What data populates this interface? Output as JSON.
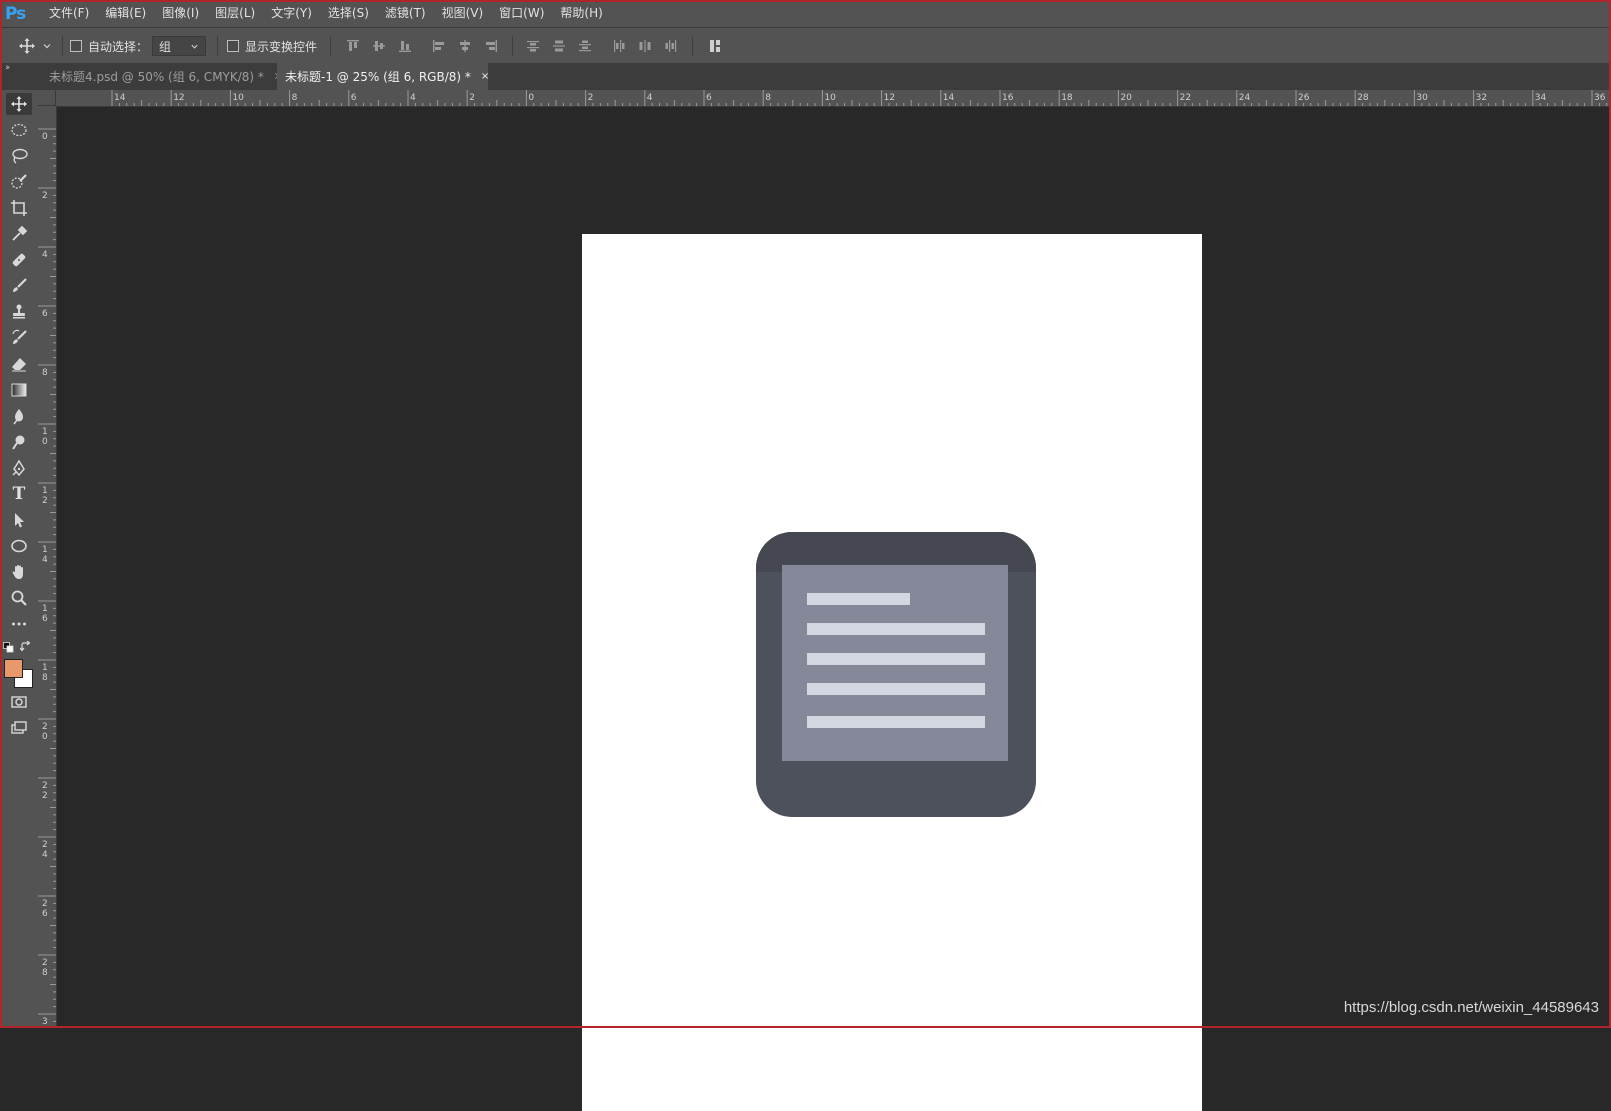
{
  "app": {
    "logo_text": "Ps",
    "brand_color": "#31a8ff",
    "frame_color": "#b0252b"
  },
  "menu": {
    "items": [
      {
        "label": "文件(F)"
      },
      {
        "label": "编辑(E)"
      },
      {
        "label": "图像(I)"
      },
      {
        "label": "图层(L)"
      },
      {
        "label": "文字(Y)"
      },
      {
        "label": "选择(S)"
      },
      {
        "label": "滤镜(T)"
      },
      {
        "label": "视图(V)"
      },
      {
        "label": "窗口(W)"
      },
      {
        "label": "帮助(H)"
      }
    ]
  },
  "options": {
    "tool_icon": "move-icon",
    "auto_select_label": "自动选择：",
    "auto_select_checked": false,
    "auto_select_value": "组",
    "show_transform_label": "显示变换控件",
    "show_transform_checked": false
  },
  "tabs": [
    {
      "label": "未标题4.psd @ 50% (组 6, CMYK/8) *",
      "close": "×",
      "active": false
    },
    {
      "label": "未标题-1 @ 25% (组 6, RGB/8) *",
      "close": "×",
      "active": true
    }
  ],
  "tools": [
    {
      "name": "move-tool",
      "icon": "move-icon",
      "active": true
    },
    {
      "name": "marquee-tool",
      "icon": "ellipse-marquee-icon"
    },
    {
      "name": "lasso-tool",
      "icon": "lasso-icon"
    },
    {
      "name": "quick-select-tool",
      "icon": "quick-select-icon"
    },
    {
      "name": "crop-tool",
      "icon": "crop-icon"
    },
    {
      "name": "eyedropper-tool",
      "icon": "eyedropper-icon"
    },
    {
      "name": "healing-tool",
      "icon": "bandage-icon"
    },
    {
      "name": "brush-tool",
      "icon": "brush-icon"
    },
    {
      "name": "stamp-tool",
      "icon": "stamp-icon"
    },
    {
      "name": "history-brush-tool",
      "icon": "history-brush-icon"
    },
    {
      "name": "eraser-tool",
      "icon": "eraser-icon"
    },
    {
      "name": "gradient-tool",
      "icon": "gradient-icon"
    },
    {
      "name": "blur-tool",
      "icon": "blur-icon"
    },
    {
      "name": "dodge-tool",
      "icon": "dodge-icon"
    },
    {
      "name": "pen-tool",
      "icon": "pen-icon"
    },
    {
      "name": "type-tool",
      "icon": "type-icon"
    },
    {
      "name": "path-select-tool",
      "icon": "arrow-icon"
    },
    {
      "name": "shape-tool",
      "icon": "ellipse-icon"
    },
    {
      "name": "hand-tool",
      "icon": "hand-icon"
    },
    {
      "name": "zoom-tool",
      "icon": "zoom-icon"
    },
    {
      "name": "more-tools",
      "icon": "ellipsis-icon"
    }
  ],
  "type_tool_glyph": "T",
  "colors": {
    "foreground": "#e8986a",
    "background": "#ffffff"
  },
  "ruler": {
    "h_labels": [
      "14",
      "12",
      "10",
      "8",
      "6",
      "4",
      "2",
      "0",
      "2",
      "4",
      "6",
      "8",
      "10",
      "12",
      "14",
      "16",
      "18",
      "20",
      "22",
      "24",
      "26",
      "28",
      "30",
      "32",
      "34",
      "36"
    ],
    "v_labels": [
      "0",
      "2",
      "4",
      "6",
      "8",
      "1\n0",
      "1\n2",
      "1\n4",
      "1\n6",
      "1\n8",
      "2\n0",
      "2\n2",
      "2\n4",
      "2\n6",
      "2\n8",
      "3"
    ]
  },
  "document": {
    "background": "#ffffff",
    "icon": {
      "body_color": "#4d515b",
      "body_top_color": "#454851",
      "sheet_color": "#858898",
      "line_color": "#d3d7e1"
    }
  },
  "watermark": "https://blog.csdn.net/weixin_44589643"
}
